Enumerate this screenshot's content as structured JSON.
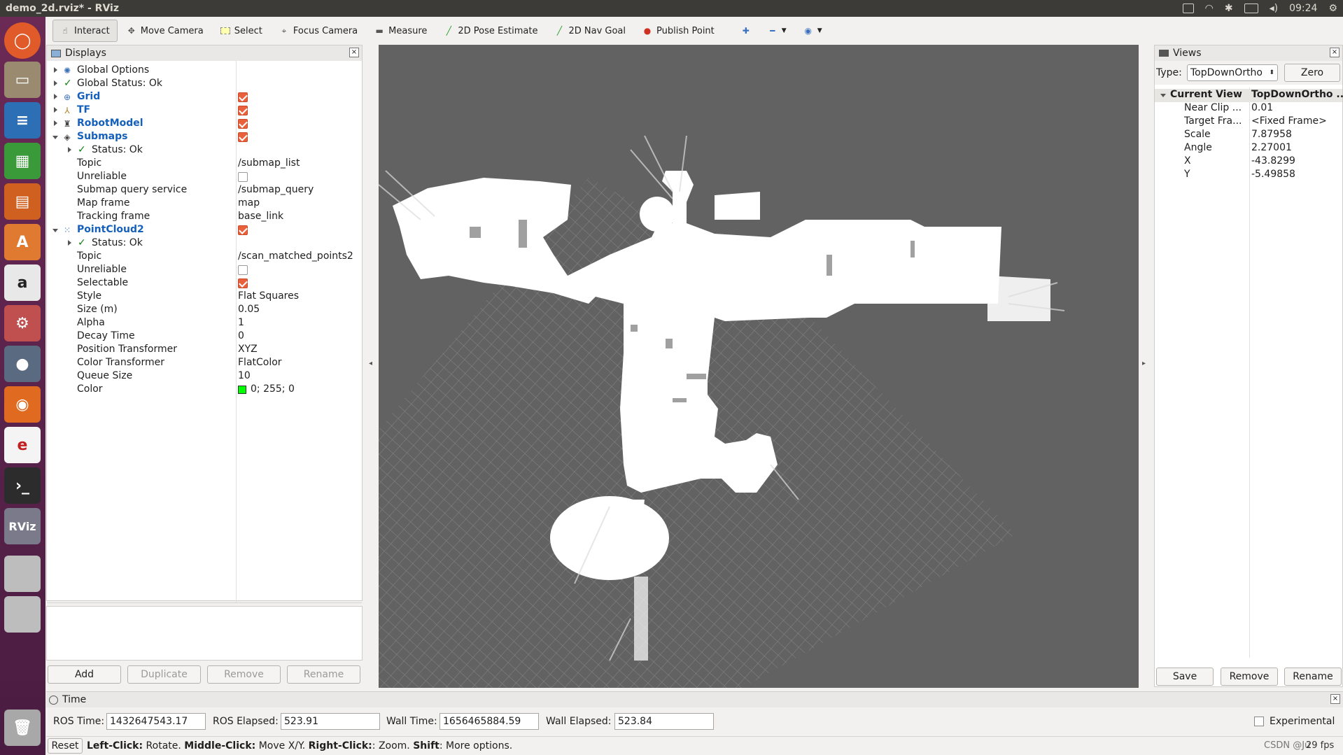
{
  "window": {
    "title": "demo_2d.rviz* - RViz",
    "clock": "09:24"
  },
  "toolbar": {
    "tools": [
      "Interact",
      "Move Camera",
      "Select",
      "Focus Camera",
      "Measure",
      "2D Pose Estimate",
      "2D Nav Goal",
      "Publish Point"
    ]
  },
  "displays": {
    "title": "Displays",
    "items": {
      "global_options": "Global Options",
      "global_status": "Global Status: Ok",
      "grid": "Grid",
      "tf": "TF",
      "robotmodel": "RobotModel",
      "submaps": "Submaps",
      "sub_status": "Status: Ok",
      "sub_topic_k": "Topic",
      "sub_topic_v": "/submap_list",
      "sub_unrel_k": "Unreliable",
      "sub_query_k": "Submap query service",
      "sub_query_v": "/submap_query",
      "sub_mapframe_k": "Map frame",
      "sub_mapframe_v": "map",
      "sub_track_k": "Tracking frame",
      "sub_track_v": "base_link",
      "pc2": "PointCloud2",
      "pc_status": "Status: Ok",
      "pc_topic_k": "Topic",
      "pc_topic_v": "/scan_matched_points2",
      "pc_unrel_k": "Unreliable",
      "pc_sel_k": "Selectable",
      "pc_style_k": "Style",
      "pc_style_v": "Flat Squares",
      "pc_size_k": "Size (m)",
      "pc_size_v": "0.05",
      "pc_alpha_k": "Alpha",
      "pc_alpha_v": "1",
      "pc_decay_k": "Decay Time",
      "pc_decay_v": "0",
      "pc_pos_k": "Position Transformer",
      "pc_pos_v": "XYZ",
      "pc_color_k": "Color Transformer",
      "pc_color_v": "FlatColor",
      "pc_queue_k": "Queue Size",
      "pc_queue_v": "10",
      "pc_colorv_k": "Color",
      "pc_colorv_v": "0; 255; 0"
    },
    "buttons": {
      "add": "Add",
      "duplicate": "Duplicate",
      "remove": "Remove",
      "rename": "Rename"
    }
  },
  "views": {
    "title": "Views",
    "type_label": "Type:",
    "type_value": "TopDownOrtho",
    "zero": "Zero",
    "current_view_k": "Current View",
    "current_view_v": "TopDownOrtho ...",
    "near_k": "Near Clip ...",
    "near_v": "0.01",
    "target_k": "Target Fra...",
    "target_v": "<Fixed Frame>",
    "scale_k": "Scale",
    "scale_v": "7.87958",
    "angle_k": "Angle",
    "angle_v": "2.27001",
    "x_k": "X",
    "x_v": "-43.8299",
    "y_k": "Y",
    "y_v": "-5.49858",
    "save": "Save",
    "remove": "Remove",
    "rename": "Rename"
  },
  "time": {
    "title": "Time",
    "ros_time_label": "ROS Time:",
    "ros_time": "1432647543.17",
    "ros_elapsed_label": "ROS Elapsed:",
    "ros_elapsed": "523.91",
    "wall_time_label": "Wall Time:",
    "wall_time": "1656465884.59",
    "wall_elapsed_label": "Wall Elapsed:",
    "wall_elapsed": "523.84",
    "experimental": "Experimental"
  },
  "status": {
    "reset": "Reset",
    "left": "Left-Click:",
    "left_t": " Rotate. ",
    "middle": "Middle-Click:",
    "middle_t": " Move X/Y. ",
    "right": "Right-Click:",
    "right_t": ": Zoom. ",
    "shift": "Shift",
    "shift_t": ": More options.",
    "fps": "29 fps",
    "watermark": "CSDN @Ju"
  },
  "colors": {
    "accent": "#e8603c",
    "point_color": "#00ff00",
    "viewport_bg": "#626262"
  }
}
